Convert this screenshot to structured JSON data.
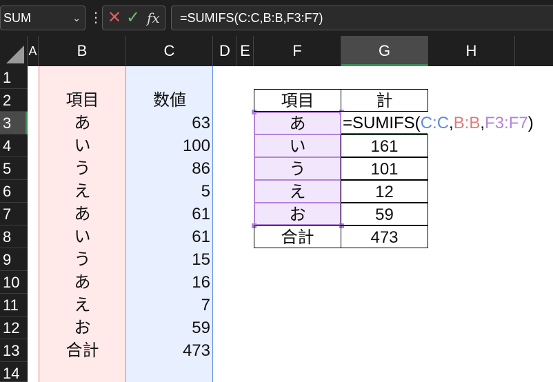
{
  "formula_bar": {
    "name_box": "SUM",
    "cancel_glyph": "✕",
    "enter_glyph": "✓",
    "fx_label": "fx",
    "formula": "=SUMIFS(C:C,B:B,F3:F7)"
  },
  "columns": [
    "A",
    "B",
    "C",
    "D",
    "E",
    "F",
    "G",
    "H"
  ],
  "rows": [
    "1",
    "2",
    "3",
    "4",
    "5",
    "6",
    "7",
    "8",
    "9",
    "10",
    "11",
    "12",
    "13",
    "14"
  ],
  "table1": {
    "header_item": "項目",
    "header_value": "数値",
    "rows": [
      {
        "item": "あ",
        "value": "63"
      },
      {
        "item": "い",
        "value": "100"
      },
      {
        "item": "う",
        "value": "86"
      },
      {
        "item": "え",
        "value": "5"
      },
      {
        "item": "あ",
        "value": "61"
      },
      {
        "item": "い",
        "value": "61"
      },
      {
        "item": "う",
        "value": "15"
      },
      {
        "item": "あ",
        "value": "16"
      },
      {
        "item": "え",
        "value": "7"
      },
      {
        "item": "お",
        "value": "59"
      }
    ],
    "total_label": "合計",
    "total_value": "473"
  },
  "table2": {
    "header_item": "項目",
    "header_total": "計",
    "rows": [
      {
        "item": "あ",
        "total": ""
      },
      {
        "item": "い",
        "total": "161"
      },
      {
        "item": "う",
        "total": "101"
      },
      {
        "item": "え",
        "total": "12"
      },
      {
        "item": "お",
        "total": "59"
      }
    ],
    "total_label": "合計",
    "total_value": "473"
  },
  "editing": {
    "prefix": "=SUMIFS(",
    "arg1": "C:C",
    "sep1": ",",
    "arg2": "B:B",
    "sep2": ",",
    "arg3": "F3:F7",
    "suffix": ")"
  },
  "colors": {
    "range_c": "#5b8de0",
    "range_b": "#e07a7a",
    "range_f": "#b283d9",
    "selected_header": "#3a8f56"
  }
}
